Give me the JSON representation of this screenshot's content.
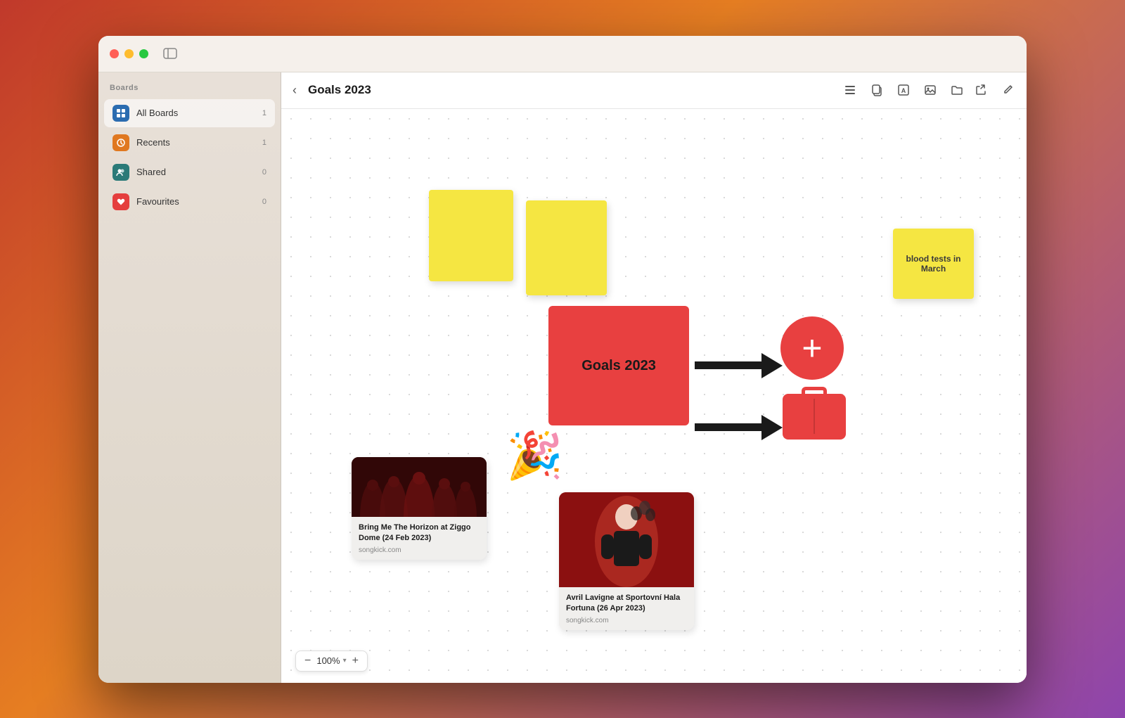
{
  "window": {
    "title": "Goals 2023",
    "zoom": "100%"
  },
  "sidebar": {
    "section_label": "Boards",
    "items": [
      {
        "id": "all-boards",
        "label": "All Boards",
        "count": "1",
        "icon": "grid",
        "active": true
      },
      {
        "id": "recents",
        "label": "Recents",
        "count": "1",
        "icon": "clock",
        "active": false
      },
      {
        "id": "shared",
        "label": "Shared",
        "count": "0",
        "icon": "people",
        "active": false
      },
      {
        "id": "favourites",
        "label": "Favourites",
        "count": "0",
        "icon": "heart",
        "active": false
      }
    ]
  },
  "toolbar": {
    "back_label": "‹",
    "title": "Goals 2023",
    "icons": [
      "list",
      "copy",
      "text",
      "image",
      "folder"
    ]
  },
  "canvas": {
    "sticky_notes": [
      {
        "id": "note1",
        "text": "",
        "color": "#f5e642"
      },
      {
        "id": "note2",
        "text": "",
        "color": "#f5e642"
      },
      {
        "id": "note3",
        "text": "blood tests in March",
        "color": "#f5e642"
      }
    ],
    "goals_box": {
      "text": "Goals 2023",
      "color": "#e84040"
    },
    "concert_cards": [
      {
        "id": "bmth",
        "title": "Bring Me The Horizon at Ziggo Dome (24 Feb 2023)",
        "source": "songkick.com"
      },
      {
        "id": "avril",
        "title": "Avril Lavigne at Sportovní Hala Fortuna (26 Apr 2023)",
        "source": "songkick.com"
      }
    ]
  },
  "zoom_controls": {
    "minus": "−",
    "value": "100%",
    "plus": "+",
    "dropdown": "▾"
  }
}
